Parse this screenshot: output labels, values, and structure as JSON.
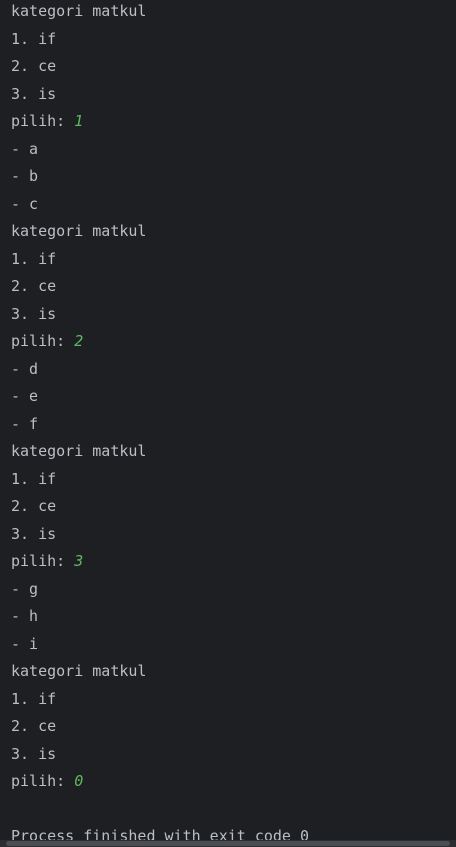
{
  "console": {
    "blocks": [
      {
        "header": "kategori matkul",
        "options": [
          "1. if",
          "2. ce",
          "3. is"
        ],
        "prompt": "pilih: ",
        "input": "1",
        "items": [
          "- a",
          "- b",
          "- c"
        ]
      },
      {
        "header": "kategori matkul",
        "options": [
          "1. if",
          "2. ce",
          "3. is"
        ],
        "prompt": "pilih: ",
        "input": "2",
        "items": [
          "- d",
          "- e",
          "- f"
        ]
      },
      {
        "header": "kategori matkul",
        "options": [
          "1. if",
          "2. ce",
          "3. is"
        ],
        "prompt": "pilih: ",
        "input": "3",
        "items": [
          "- g",
          "- h",
          "- i"
        ]
      },
      {
        "header": "kategori matkul",
        "options": [
          "1. if",
          "2. ce",
          "3. is"
        ],
        "prompt": "pilih: ",
        "input": "0",
        "items": []
      }
    ],
    "exit_message": "Process finished with exit code 0"
  },
  "colors": {
    "background": "#1e1f22",
    "text": "#bcbec4",
    "user_input": "#5fb760"
  }
}
